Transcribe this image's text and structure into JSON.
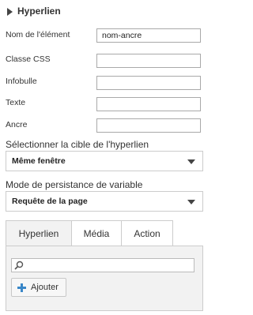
{
  "section": {
    "title": "Hyperlien",
    "icon": "caret-right-icon"
  },
  "fields": [
    {
      "label": "Nom de l'élément",
      "value": "nom-ancre"
    },
    {
      "label": "Classe CSS",
      "value": ""
    },
    {
      "label": "Infobulle",
      "value": ""
    },
    {
      "label": "Texte",
      "value": ""
    },
    {
      "label": "Ancre",
      "value": ""
    }
  ],
  "target": {
    "label": "Sélectionner la cible de l'hyperlien",
    "selected": "Même fenêtre"
  },
  "persistence": {
    "label": "Mode de persistance de variable",
    "selected": "Requête de la page"
  },
  "tabs": [
    {
      "label": "Hyperlien",
      "active": true
    },
    {
      "label": "Média",
      "active": false
    },
    {
      "label": "Action",
      "active": false
    }
  ],
  "panel": {
    "search": {
      "value": "",
      "icon": "search-icon"
    },
    "add_button": {
      "label": "Ajouter",
      "icon": "plus-icon",
      "icon_color": "#3a87c8"
    }
  }
}
